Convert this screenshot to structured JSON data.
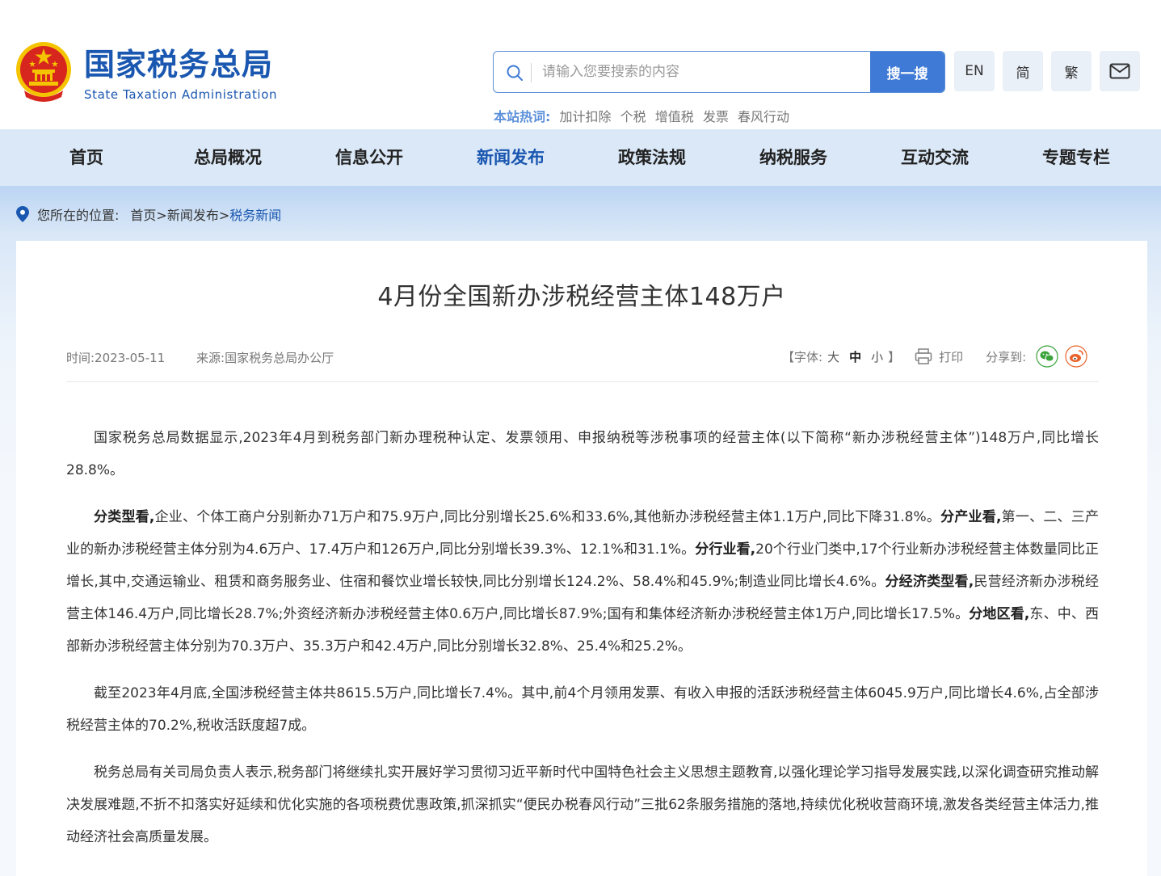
{
  "header": {
    "site_name": "国家税务总局",
    "site_name_en": "State Taxation Administration",
    "search": {
      "placeholder": "请输入您要搜索的内容",
      "button_label": "搜一搜"
    },
    "tools": {
      "en_label": "EN",
      "simplified_label": "简",
      "traditional_label": "繁"
    },
    "hotwords": {
      "label": "本站热词:",
      "items": [
        "加计扣除",
        "个税",
        "增值税",
        "发票",
        "春风行动"
      ]
    }
  },
  "nav": {
    "items": [
      {
        "label": "首页"
      },
      {
        "label": "总局概况"
      },
      {
        "label": "信息公开"
      },
      {
        "label": "新闻发布"
      },
      {
        "label": "政策法规"
      },
      {
        "label": "纳税服务"
      },
      {
        "label": "互动交流"
      },
      {
        "label": "专题专栏"
      }
    ],
    "active": "新闻发布"
  },
  "breadcrumb": {
    "prefix": "您所在的位置:",
    "path": "首页>新闻发布>",
    "current": "税务新闻"
  },
  "article": {
    "title": "4月份全国新办涉税经营主体148万户",
    "time_label": "时间:2023-05-11",
    "source_label": "来源:国家税务总局办公厅",
    "font_size": {
      "open": "【字体:",
      "large": "大",
      "medium": "中",
      "small": "小",
      "close": "】"
    },
    "print_label": "打印",
    "share_label": "分享到:",
    "paragraphs": {
      "p1": "国家税务总局数据显示,2023年4月到税务部门新办理税种认定、发票领用、申报纳税等涉税事项的经营主体(以下简称“新办涉税经营主体”)148万户,同比增长28.8%。",
      "p2_h1": "分类型看,",
      "p2_t1": "企业、个体工商户分别新办71万户和75.9万户,同比分别增长25.6%和33.6%,其他新办涉税经营主体1.1万户,同比下降31.8%。",
      "p2_h2": "分产业看,",
      "p2_t2": "第一、二、三产业的新办涉税经营主体分别为4.6万户、17.4万户和126万户,同比分别增长39.3%、12.1%和31.1%。",
      "p2_h3": "分行业看,",
      "p2_t3": "20个行业门类中,17个行业新办涉税经营主体数量同比正增长,其中,交通运输业、租赁和商务服务业、住宿和餐饮业增长较快,同比分别增长124.2%、58.4%和45.9%;制造业同比增长4.6%。",
      "p2_h4": "分经济类型看,",
      "p2_t4": "民营经济新办涉税经营主体146.4万户,同比增长28.7%;外资经济新办涉税经营主体0.6万户,同比增长87.9%;国有和集体经济新办涉税经营主体1万户,同比增长17.5%。",
      "p2_h5": "分地区看,",
      "p2_t5": "东、中、西部新办涉税经营主体分别为70.3万户、35.3万户和42.4万户,同比分别增长32.8%、25.4%和25.2%。",
      "p3": "截至2023年4月底,全国涉税经营主体共8615.5万户,同比增长7.4%。其中,前4个月领用发票、有收入申报的活跃涉税经营主体6045.9万户,同比增长4.6%,占全部涉税经营主体的70.2%,税收活跃度超7成。",
      "p4": "税务总局有关司局负责人表示,税务部门将继续扎实开展好学习贯彻习近平新时代中国特色社会主义思想主题教育,以强化理论学习指导发展实践,以深化调查研究推动解决发展难题,不折不扣落实好延续和优化实施的各项税费优惠政策,抓深抓实“便民办税春风行动”三批62条服务措施的落地,持续优化税收营商环境,激发各类经营主体活力,推动经济社会高质量发展。"
    }
  },
  "colors": {
    "brand_blue": "#1a57b0",
    "search_button": "#3f7ad6",
    "nav_background": "#dbe8f7",
    "emblem_red": "#d7261e",
    "emblem_gold": "#f5c400",
    "wechat_green": "#3aa33b",
    "weibo_orange": "#e8632a"
  },
  "icons": {
    "logo": "national-emblem-icon",
    "search": "search-icon",
    "mail": "mail-icon",
    "location": "location-pin-icon",
    "print": "printer-icon",
    "wechat": "wechat-icon",
    "weibo": "weibo-icon"
  }
}
